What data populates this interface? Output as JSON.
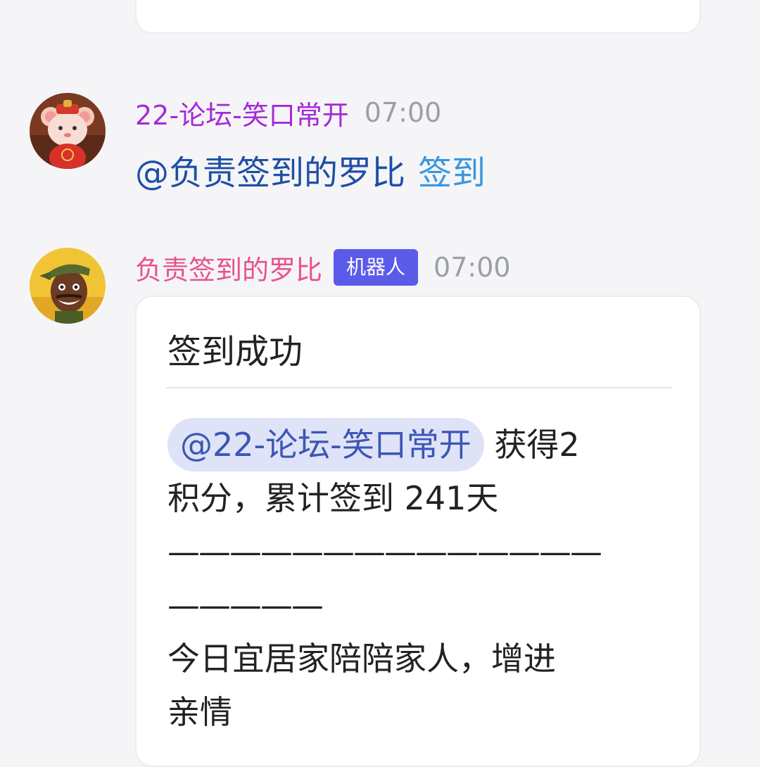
{
  "messages": [
    {
      "sender": "22-论坛-笑口常开",
      "time": "07:00",
      "mention": "@负责签到的罗比",
      "command": "签到"
    },
    {
      "sender": "负责签到的罗比",
      "badge": "机器人",
      "time": "07:00",
      "card": {
        "title": "签到成功",
        "mention": "@22-论坛-笑口常开",
        "text_after_mention_line1": "获得2",
        "text_line2": "积分，累计签到 241天",
        "separator_line1": "——————————————",
        "separator_line2": "—————",
        "fortune_line1": "今日宜居家陪陪家人，增进",
        "fortune_line2": "亲情"
      }
    }
  ],
  "colors": {
    "sender1": "#a52ad8",
    "sender2": "#e9528a",
    "badge_bg": "#5b5bea",
    "mention_chip_bg": "#dfe3f7",
    "link": "#3a97df"
  },
  "icons": {
    "avatar1": "mouse-mascot-avatar",
    "avatar2": "cartoon-man-avatar"
  }
}
